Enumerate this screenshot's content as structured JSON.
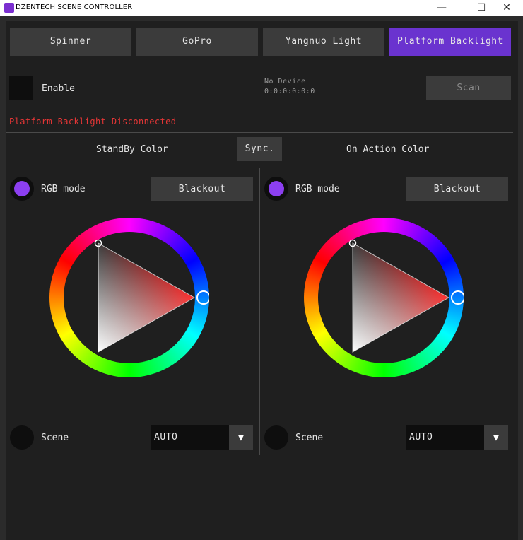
{
  "window": {
    "title": "DZENTECH SCENE CONTROLLER",
    "minimize_glyph": "—",
    "maximize_glyph": "☐",
    "close_glyph": "✕"
  },
  "tabs": [
    {
      "label": "Spinner",
      "active": false
    },
    {
      "label": "GoPro",
      "active": false
    },
    {
      "label": "Yangnuo Light",
      "active": false
    },
    {
      "label": "Platform Backlight",
      "active": true
    }
  ],
  "device": {
    "enable_label": "Enable",
    "enabled": false,
    "name": "No Device",
    "address": "0:0:0:0:0:0",
    "scan_label": "Scan",
    "status": "Platform Backlight Disconnected"
  },
  "sync_label": "Sync.",
  "standby": {
    "title": "StandBy Color",
    "rgb_mode_label": "RGB mode",
    "blackout_label": "Blackout",
    "scene_label": "Scene",
    "scene_value": "AUTO"
  },
  "action": {
    "title": "On Action Color",
    "rgb_mode_label": "RGB mode",
    "blackout_label": "Blackout",
    "scene_label": "Scene",
    "scene_value": "AUTO"
  },
  "colors": {
    "accent": "#6a33cf",
    "radio_on": "#8c3ff0",
    "error": "#e53636",
    "selected_color": "#ff0000"
  },
  "icons": {
    "dropdown": "▼"
  }
}
